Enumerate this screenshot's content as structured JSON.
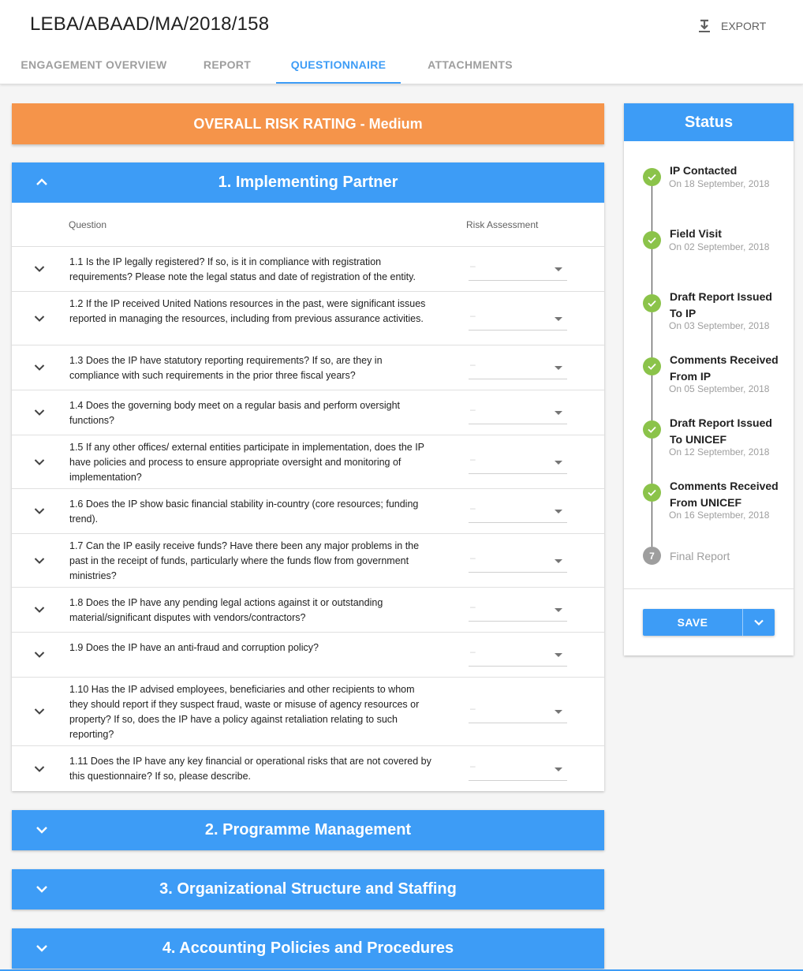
{
  "header": {
    "title": "LEBA/ABAAD/MA/2018/158",
    "export_label": "EXPORT",
    "export_icon": "download-icon",
    "tabs": [
      {
        "label": "ENGAGEMENT OVERVIEW"
      },
      {
        "label": "REPORT"
      },
      {
        "label": "QUESTIONNAIRE"
      },
      {
        "label": "ATTACHMENTS"
      }
    ],
    "active_tab": "QUESTIONNAIRE"
  },
  "risk_banner": "OVERALL RISK RATING - Medium",
  "sections": [
    {
      "title": "1. Implementing Partner",
      "expanded": true,
      "col_question": "Question",
      "col_risk": "Risk Assessment",
      "questions": [
        {
          "text": "1.1 Is the IP legally registered? If so, is it in compliance with registration requirements? Please note the legal status and date of registration of the entity.",
          "value": "–"
        },
        {
          "text": "1.2 If the IP received United Nations resources in the past, were significant issues reported in managing the resources, including from previous assurance activities.",
          "value": "–"
        },
        {
          "text": "1.3 Does the IP have statutory reporting requirements? If so, are they in compliance with such requirements in the prior three fiscal years?",
          "value": "–"
        },
        {
          "text": "1.4 Does the governing body meet on a regular basis and perform oversight functions?",
          "value": "–"
        },
        {
          "text": "1.5 If any other offices/ external entities participate in implementation, does the IP have policies and process to ensure appropriate oversight and monitoring of implementation?",
          "value": "–"
        },
        {
          "text": "1.6 Does the IP show basic financial stability in-country (core resources; funding trend).",
          "value": "–"
        },
        {
          "text": "1.7 Can the IP easily receive funds? Have there been any major problems in the past in the receipt of funds, particularly where the funds flow from government ministries?",
          "value": "–"
        },
        {
          "text": "1.8 Does the IP have any pending legal actions against it or outstanding material/significant disputes with vendors/contractors?",
          "value": "–"
        },
        {
          "text": "1.9 Does the IP have an anti-fraud and corruption policy?",
          "value": "–"
        },
        {
          "text": "1.10 Has the IP advised employees, beneficiaries and other recipients to whom they should report if they suspect fraud, waste or misuse of agency resources or property? If so, does the IP have a policy against retaliation relating to such reporting?",
          "value": "–"
        },
        {
          "text": "1.11 Does the IP have any key financial or operational risks that are not covered by this questionnaire? If so, please describe.",
          "value": "–"
        }
      ]
    },
    {
      "title": "2. Programme Management",
      "expanded": false
    },
    {
      "title": "3. Organizational Structure and Staffing",
      "expanded": false
    },
    {
      "title": "4. Accounting Policies and Procedures",
      "expanded": false
    }
  ],
  "status": {
    "title": "Status",
    "steps": [
      {
        "title": "IP Contacted",
        "date": "On 18 September, 2018",
        "done": true
      },
      {
        "title": "Field Visit",
        "date": "On 02 September, 2018",
        "done": true
      },
      {
        "title": "Draft Report Issued To IP",
        "date": "On 03 September, 2018",
        "done": true
      },
      {
        "title": "Comments Received From IP",
        "date": "On 05 September, 2018",
        "done": true
      },
      {
        "title": "Draft Report Issued To UNICEF",
        "date": "On 12 September, 2018",
        "done": true
      },
      {
        "title": "Comments Received From UNICEF",
        "date": "On 16 September, 2018",
        "done": true
      },
      {
        "title": "Final Report",
        "number": "7",
        "done": false
      }
    ],
    "save_label": "SAVE"
  },
  "colors": {
    "primary": "#3d9cf6",
    "risk_medium": "#f5944a",
    "done": "#8bc34a",
    "pending": "#9e9e9e"
  }
}
